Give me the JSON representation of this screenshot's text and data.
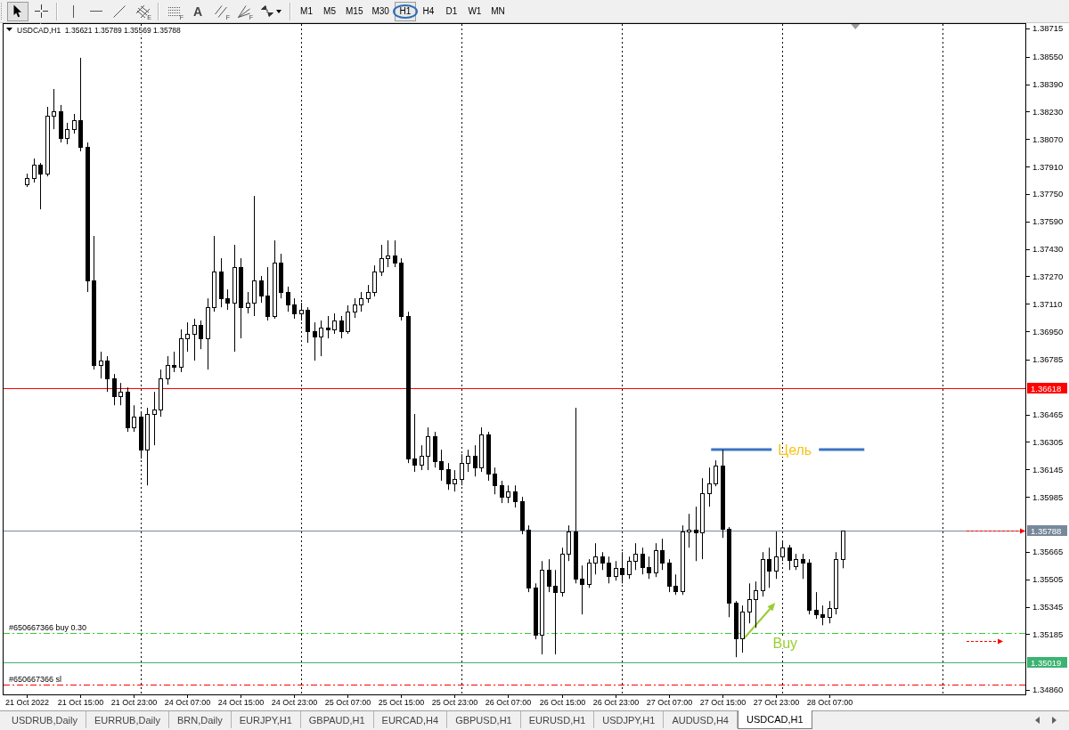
{
  "toolbar": {
    "tool_groups": [
      [
        {
          "kind": "cursor",
          "selected": true
        },
        {
          "kind": "crosshair",
          "selected": false
        }
      ],
      [
        {
          "kind": "vline",
          "selected": false
        },
        {
          "kind": "hline",
          "selected": false
        },
        {
          "kind": "trendline",
          "selected": false
        },
        {
          "kind": "channel",
          "badge": "E",
          "selected": false
        }
      ],
      [
        {
          "kind": "levels",
          "badge": "F",
          "selected": false
        },
        {
          "kind": "text",
          "glyph": "A",
          "selected": false
        },
        {
          "kind": "parallels",
          "badge": "F",
          "selected": false
        },
        {
          "kind": "fan",
          "badge": "F",
          "selected": false
        },
        {
          "kind": "arrows",
          "selected": false
        }
      ]
    ],
    "timeframes": [
      {
        "label": "M1",
        "selected": false,
        "circled": false
      },
      {
        "label": "M5",
        "selected": false,
        "circled": false
      },
      {
        "label": "M15",
        "selected": false,
        "circled": false
      },
      {
        "label": "M30",
        "selected": false,
        "circled": false
      },
      {
        "label": "H1",
        "selected": true,
        "circled": true
      },
      {
        "label": "H4",
        "selected": false,
        "circled": false
      },
      {
        "label": "D1",
        "selected": false,
        "circled": false
      },
      {
        "label": "W1",
        "selected": false,
        "circled": false
      },
      {
        "label": "MN",
        "selected": false,
        "circled": false
      }
    ]
  },
  "chart": {
    "chart_data": {
      "type": "candlestick",
      "title": "USDCAD,H1  1.35621 1.35789 1.35569 1.35788",
      "categories": [
        null,
        null,
        null,
        "21 Oct 2022",
        null,
        null,
        null,
        null,
        null,
        null,
        null,
        "21 Oct 15:00",
        null,
        null,
        null,
        null,
        null,
        null,
        null,
        "21 Oct 23:00",
        null,
        null,
        null,
        null,
        null,
        null,
        null,
        "24 Oct 07:00",
        null,
        null,
        null,
        null,
        null,
        null,
        null,
        "24 Oct 15:00",
        null,
        null,
        null,
        null,
        null,
        null,
        null,
        "24 Oct 23:00",
        null,
        null,
        null,
        null,
        null,
        null,
        null,
        "25 Oct 07:00",
        null,
        null,
        null,
        null,
        null,
        null,
        null,
        "25 Oct 15:00",
        null,
        null,
        null,
        null,
        null,
        null,
        null,
        "25 Oct 23:00",
        null,
        null,
        null,
        null,
        null,
        null,
        null,
        "26 Oct 07:00",
        null,
        null,
        null,
        null,
        null,
        null,
        null,
        "26 Oct 15:00",
        null,
        null,
        null,
        null,
        null,
        null,
        null,
        "26 Oct 23:00",
        null,
        null,
        null,
        null,
        null,
        null,
        null,
        "27 Oct 07:00",
        null,
        null,
        null,
        null,
        null,
        null,
        null,
        "27 Oct 15:00",
        null,
        null,
        null,
        null,
        null,
        null,
        null,
        "27 Oct 23:00",
        null,
        null,
        null,
        null,
        null,
        null,
        null,
        "28 Oct 07:00",
        null,
        null,
        null,
        null,
        null,
        null,
        null,
        null,
        null,
        null,
        null,
        null,
        null,
        null,
        null,
        null,
        null,
        null,
        null,
        null,
        null,
        null,
        null,
        null,
        null,
        null,
        null,
        null,
        null
      ],
      "ohlc": [
        null,
        null,
        null,
        [
          1.37807,
          1.37869,
          1.37791,
          1.37843
        ],
        [
          1.37843,
          1.37957,
          1.37817,
          1.37921
        ],
        [
          1.37921,
          1.37931,
          1.37661,
          1.37869
        ],
        [
          1.37869,
          1.38258,
          1.37853,
          1.38206
        ],
        [
          1.38206,
          1.38362,
          1.38128,
          1.38232
        ],
        [
          1.38232,
          1.38269,
          1.38051,
          1.38077
        ],
        [
          1.38077,
          1.38165,
          1.3804,
          1.38128
        ],
        [
          1.38128,
          1.38217,
          1.38102,
          1.3818
        ],
        [
          1.3818,
          1.38544,
          1.37999,
          1.38025
        ],
        [
          1.38025,
          1.38051,
          1.37179,
          1.37246
        ],
        [
          1.37246,
          1.37506,
          1.36727,
          1.36753
        ],
        [
          1.36753,
          1.36831,
          1.36675,
          1.36779
        ],
        [
          1.36779,
          1.36805,
          1.36597,
          1.36675
        ],
        [
          1.36675,
          1.36701,
          1.36519,
          1.36571
        ],
        [
          1.36571,
          1.36649,
          1.36519,
          1.36597
        ],
        [
          1.36597,
          1.36623,
          1.36364,
          1.3639
        ],
        [
          1.3639,
          1.36519,
          1.36364,
          1.36452
        ],
        [
          1.36452,
          1.36483,
          1.36208,
          1.3626
        ],
        [
          1.3626,
          1.36504,
          1.36052,
          1.36468
        ],
        [
          1.36468,
          1.36597,
          1.36286,
          1.36494
        ],
        [
          1.36494,
          1.36727,
          1.36452,
          1.36675
        ],
        [
          1.36675,
          1.36805,
          1.36639,
          1.36753
        ],
        [
          1.36753,
          1.36831,
          1.36712,
          1.36743
        ],
        [
          1.36743,
          1.36961,
          1.36712,
          1.36909
        ],
        [
          1.36909,
          1.37002,
          1.36831,
          1.36935
        ],
        [
          1.36935,
          1.37023,
          1.36779,
          1.36987
        ],
        [
          1.36987,
          1.37013,
          1.36846,
          1.36909
        ],
        [
          1.36909,
          1.37142,
          1.36727,
          1.3709
        ],
        [
          1.3709,
          1.37506,
          1.37064,
          1.37298
        ],
        [
          1.37298,
          1.37376,
          1.3709,
          1.37142
        ],
        [
          1.37142,
          1.37194,
          1.37075,
          1.37116
        ],
        [
          1.37116,
          1.37454,
          1.36831,
          1.37324
        ],
        [
          1.37324,
          1.37376,
          1.36909,
          1.3709
        ],
        [
          1.3709,
          1.37179,
          1.37054,
          1.37116
        ],
        [
          1.37116,
          1.37739,
          1.37039,
          1.37246
        ],
        [
          1.37246,
          1.37272,
          1.37116,
          1.37158
        ],
        [
          1.37158,
          1.37324,
          1.37013,
          1.37039
        ],
        [
          1.37039,
          1.3748,
          1.37023,
          1.3735
        ],
        [
          1.3735,
          1.37402,
          1.37142,
          1.37179
        ],
        [
          1.37179,
          1.3721,
          1.37064,
          1.37106
        ],
        [
          1.37106,
          1.37142,
          1.37023,
          1.37054
        ],
        [
          1.37054,
          1.37116,
          1.37013,
          1.37075
        ],
        [
          1.37075,
          1.3709,
          1.36883,
          1.3695
        ],
        [
          1.3695,
          1.37002,
          1.36779,
          1.36919
        ],
        [
          1.36919,
          1.37013,
          1.36805,
          1.36971
        ],
        [
          1.36971,
          1.37039,
          1.36909,
          1.36961
        ],
        [
          1.36961,
          1.37054,
          1.36935,
          1.37013
        ],
        [
          1.37013,
          1.37039,
          1.36909,
          1.3695
        ],
        [
          1.3695,
          1.37101,
          1.36935,
          1.37064
        ],
        [
          1.37064,
          1.37142,
          1.37028,
          1.37106
        ],
        [
          1.37106,
          1.37179,
          1.37064,
          1.37142
        ],
        [
          1.37142,
          1.3722,
          1.37116,
          1.37179
        ],
        [
          1.37179,
          1.37334,
          1.37153,
          1.37298
        ],
        [
          1.37298,
          1.37454,
          1.37272,
          1.37376
        ],
        [
          1.37376,
          1.3748,
          1.37324,
          1.37392
        ],
        [
          1.37392,
          1.3748,
          1.37324,
          1.3735
        ],
        [
          1.3735,
          1.37376,
          1.37013,
          1.37039
        ],
        [
          1.37039,
          1.37064,
          1.36182,
          1.36208
        ],
        [
          1.36208,
          1.36468,
          1.36131,
          1.36172
        ],
        [
          1.36172,
          1.36286,
          1.36141,
          1.36224
        ],
        [
          1.36224,
          1.3639,
          1.36141,
          1.36338
        ],
        [
          1.36338,
          1.36364,
          1.36156,
          1.36193
        ],
        [
          1.36193,
          1.3626,
          1.36079,
          1.36146
        ],
        [
          1.36146,
          1.36182,
          1.36026,
          1.36063
        ],
        [
          1.36063,
          1.36141,
          1.36016,
          1.36089
        ],
        [
          1.36089,
          1.36234,
          1.36052,
          1.36182
        ],
        [
          1.36182,
          1.3626,
          1.36131,
          1.36224
        ],
        [
          1.36224,
          1.36286,
          1.36104,
          1.36156
        ],
        [
          1.36156,
          1.3639,
          1.36131,
          1.36348
        ],
        [
          1.36348,
          1.36364,
          1.36079,
          1.3612
        ],
        [
          1.3612,
          1.36156,
          1.36,
          1.36052
        ],
        [
          1.36052,
          1.36079,
          1.35949,
          1.35985
        ],
        [
          1.35985,
          1.36052,
          1.35949,
          1.36016
        ],
        [
          1.36016,
          1.36052,
          1.35923,
          1.35959
        ],
        [
          1.35959,
          1.35985,
          1.35767,
          1.35793
        ],
        [
          1.35793,
          1.35819,
          1.3543,
          1.35455
        ],
        [
          1.35455,
          1.35481,
          1.35155,
          1.35181
        ],
        [
          1.35181,
          1.35611,
          1.35067,
          1.35559
        ],
        [
          1.35559,
          1.35622,
          1.3543,
          1.35466
        ],
        [
          1.35466,
          1.35559,
          1.35067,
          1.3543
        ],
        [
          1.3543,
          1.35689,
          1.35404,
          1.35653
        ],
        [
          1.35653,
          1.35819,
          1.35611,
          1.35783
        ],
        [
          1.35783,
          1.36504,
          1.35481,
          1.35507
        ],
        [
          1.35507,
          1.35585,
          1.353,
          1.35476
        ],
        [
          1.35476,
          1.35622,
          1.35455,
          1.35601
        ],
        [
          1.35601,
          1.35715,
          1.35533,
          1.35637
        ],
        [
          1.35637,
          1.35663,
          1.35559,
          1.35601
        ],
        [
          1.35601,
          1.35637,
          1.35481,
          1.35523
        ],
        [
          1.35523,
          1.35611,
          1.35497,
          1.3557
        ],
        [
          1.3557,
          1.35663,
          1.35481,
          1.35533
        ],
        [
          1.35533,
          1.35637,
          1.35507,
          1.35611
        ],
        [
          1.35611,
          1.35715,
          1.35559,
          1.35653
        ],
        [
          1.35653,
          1.35689,
          1.35533,
          1.35575
        ],
        [
          1.35575,
          1.35637,
          1.35507,
          1.35544
        ],
        [
          1.35544,
          1.35715,
          1.35518,
          1.35674
        ],
        [
          1.35674,
          1.35741,
          1.35559,
          1.35601
        ],
        [
          1.35601,
          1.35622,
          1.3543,
          1.35466
        ],
        [
          1.35466,
          1.35533,
          1.35414,
          1.35435
        ],
        [
          1.35435,
          1.35819,
          1.35414,
          1.35783
        ],
        [
          1.35783,
          1.35886,
          1.35689,
          1.35793
        ],
        [
          1.35793,
          1.35928,
          1.35611,
          1.35777
        ],
        [
          1.35777,
          1.36094,
          1.35622,
          1.36006
        ],
        [
          1.36006,
          1.36156,
          1.35928,
          1.36063
        ],
        [
          1.36063,
          1.36198,
          1.36047,
          1.36167
        ],
        [
          1.36167,
          1.3626,
          1.35746,
          1.35798
        ],
        [
          1.35798,
          1.35809,
          1.35284,
          1.35367
        ],
        [
          1.35367,
          1.35378,
          1.35051,
          1.3516
        ],
        [
          1.3516,
          1.35352,
          1.35077,
          1.35315
        ],
        [
          1.35315,
          1.35481,
          1.35248,
          1.35388
        ],
        [
          1.35388,
          1.35492,
          1.35222,
          1.3544
        ],
        [
          1.3544,
          1.35663,
          1.35404,
          1.35622
        ],
        [
          1.35622,
          1.35689,
          1.35455,
          1.35554
        ],
        [
          1.35554,
          1.35783,
          1.35507,
          1.35637
        ],
        [
          1.35637,
          1.35725,
          1.35611,
          1.35689
        ],
        [
          1.35689,
          1.35705,
          1.35559,
          1.35616
        ],
        [
          1.3558,
          1.35653,
          1.35559,
          1.35622
        ],
        [
          1.35622,
          1.35653,
          1.35507,
          1.35601
        ],
        [
          1.35601,
          1.35622,
          1.353,
          1.35326
        ],
        [
          1.35326,
          1.3543,
          1.35274,
          1.353
        ],
        [
          1.353,
          1.35352,
          1.35237,
          1.35284
        ],
        [
          1.35284,
          1.35378,
          1.35248,
          1.35336
        ],
        [
          1.35336,
          1.35663,
          1.353,
          1.35622
        ],
        [
          1.35621,
          1.35789,
          1.35569,
          1.35788
        ],
        null,
        null,
        null,
        null,
        null,
        null,
        null,
        null,
        null,
        null,
        null,
        null,
        null,
        null,
        null,
        null,
        null,
        null,
        null,
        null,
        null,
        null,
        null,
        null,
        null,
        null,
        null
      ],
      "ylim": [
        1.34834,
        1.38746
      ],
      "yticks": [
        {
          "value": 1.3486,
          "label": "1.34860"
        },
        {
          "value": 1.35185,
          "label": "1.35185"
        },
        {
          "value": 1.35345,
          "label": "1.35345"
        },
        {
          "value": 1.35505,
          "label": "1.35505"
        },
        {
          "value": 1.35665,
          "label": "1.35665"
        },
        {
          "value": 1.35985,
          "label": "1.35985"
        },
        {
          "value": 1.36145,
          "label": "1.36145"
        },
        {
          "value": 1.36305,
          "label": "1.36305"
        },
        {
          "value": 1.36465,
          "label": "1.36465"
        },
        {
          "value": 1.36785,
          "label": "1.36785"
        },
        {
          "value": 1.3695,
          "label": "1.36950"
        },
        {
          "value": 1.3711,
          "label": "1.37110"
        },
        {
          "value": 1.3727,
          "label": "1.37270"
        },
        {
          "value": 1.3743,
          "label": "1.37430"
        },
        {
          "value": 1.3759,
          "label": "1.37590"
        },
        {
          "value": 1.3775,
          "label": "1.37750"
        },
        {
          "value": 1.3791,
          "label": "1.37910"
        },
        {
          "value": 1.3807,
          "label": "1.38070"
        },
        {
          "value": 1.3823,
          "label": "1.38230"
        },
        {
          "value": 1.3839,
          "label": "1.38390"
        },
        {
          "value": 1.3855,
          "label": "1.38550"
        },
        {
          "value": 1.38715,
          "label": "1.38715"
        }
      ],
      "grid": "x",
      "ref_lines": [
        {
          "axis": "y",
          "value": 1.36618,
          "label": "1.36618",
          "color": "#ff0000",
          "line_style": "solid"
        },
        {
          "axis": "y",
          "value": 1.35788,
          "label": "1.35788",
          "color": "#778899",
          "line_style": "solid"
        },
        {
          "axis": "y",
          "value": 1.3519,
          "label": "#650667366 buy 0.30",
          "color": "#32cd32",
          "line_style": "dashdot"
        },
        {
          "axis": "y",
          "value": 1.35019,
          "label": "1.35019",
          "color": "#3cb371",
          "line_style": "solid"
        },
        {
          "axis": "y",
          "value": 1.3489,
          "label": "#650667366 sl",
          "color": "#ff0000",
          "line_style": "dashdot"
        }
      ],
      "annotations": [
        "Цель",
        "Buy"
      ]
    }
  },
  "tabs": [
    {
      "label": "USDRUB,Daily",
      "selected": false
    },
    {
      "label": "EURRUB,Daily",
      "selected": false
    },
    {
      "label": "BRN,Daily",
      "selected": false
    },
    {
      "label": "EURJPY,H1",
      "selected": false
    },
    {
      "label": "GBPAUD,H1",
      "selected": false
    },
    {
      "label": "EURCAD,H4",
      "selected": false
    },
    {
      "label": "GBPUSD,H1",
      "selected": false
    },
    {
      "label": "EURUSD,H1",
      "selected": false
    },
    {
      "label": "USDJPY,H1",
      "selected": false
    },
    {
      "label": "AUDUSD,H4",
      "selected": false
    },
    {
      "label": "USDCAD,H1",
      "selected": true
    }
  ]
}
